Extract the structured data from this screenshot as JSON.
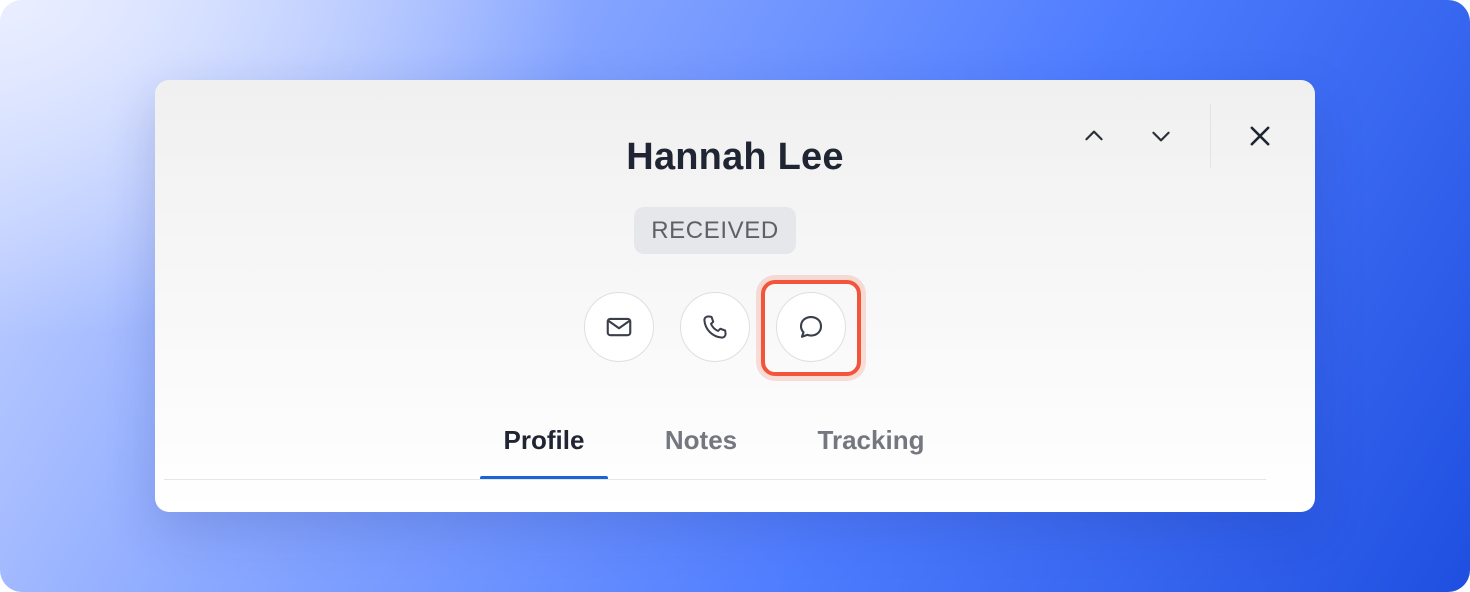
{
  "contact": {
    "name": "Hannah Lee",
    "status": "RECEIVED"
  },
  "actions": [
    {
      "name": "email",
      "icon": "mail-icon"
    },
    {
      "name": "call",
      "icon": "phone-icon"
    },
    {
      "name": "message",
      "icon": "chat-bubble-icon",
      "highlighted": true
    }
  ],
  "tabs": [
    {
      "label": "Profile",
      "active": true
    },
    {
      "label": "Notes",
      "active": false
    },
    {
      "label": "Tracking",
      "active": false
    }
  ],
  "header_controls": [
    {
      "name": "previous",
      "icon": "chevron-up-icon"
    },
    {
      "name": "next",
      "icon": "chevron-down-icon"
    },
    {
      "name": "close",
      "icon": "close-icon"
    }
  ],
  "colors": {
    "accent": "#1d63d8",
    "highlight": "#f2553a",
    "badge_bg": "#e6e7ea",
    "text_primary": "#1f2533",
    "text_muted": "#747780"
  }
}
